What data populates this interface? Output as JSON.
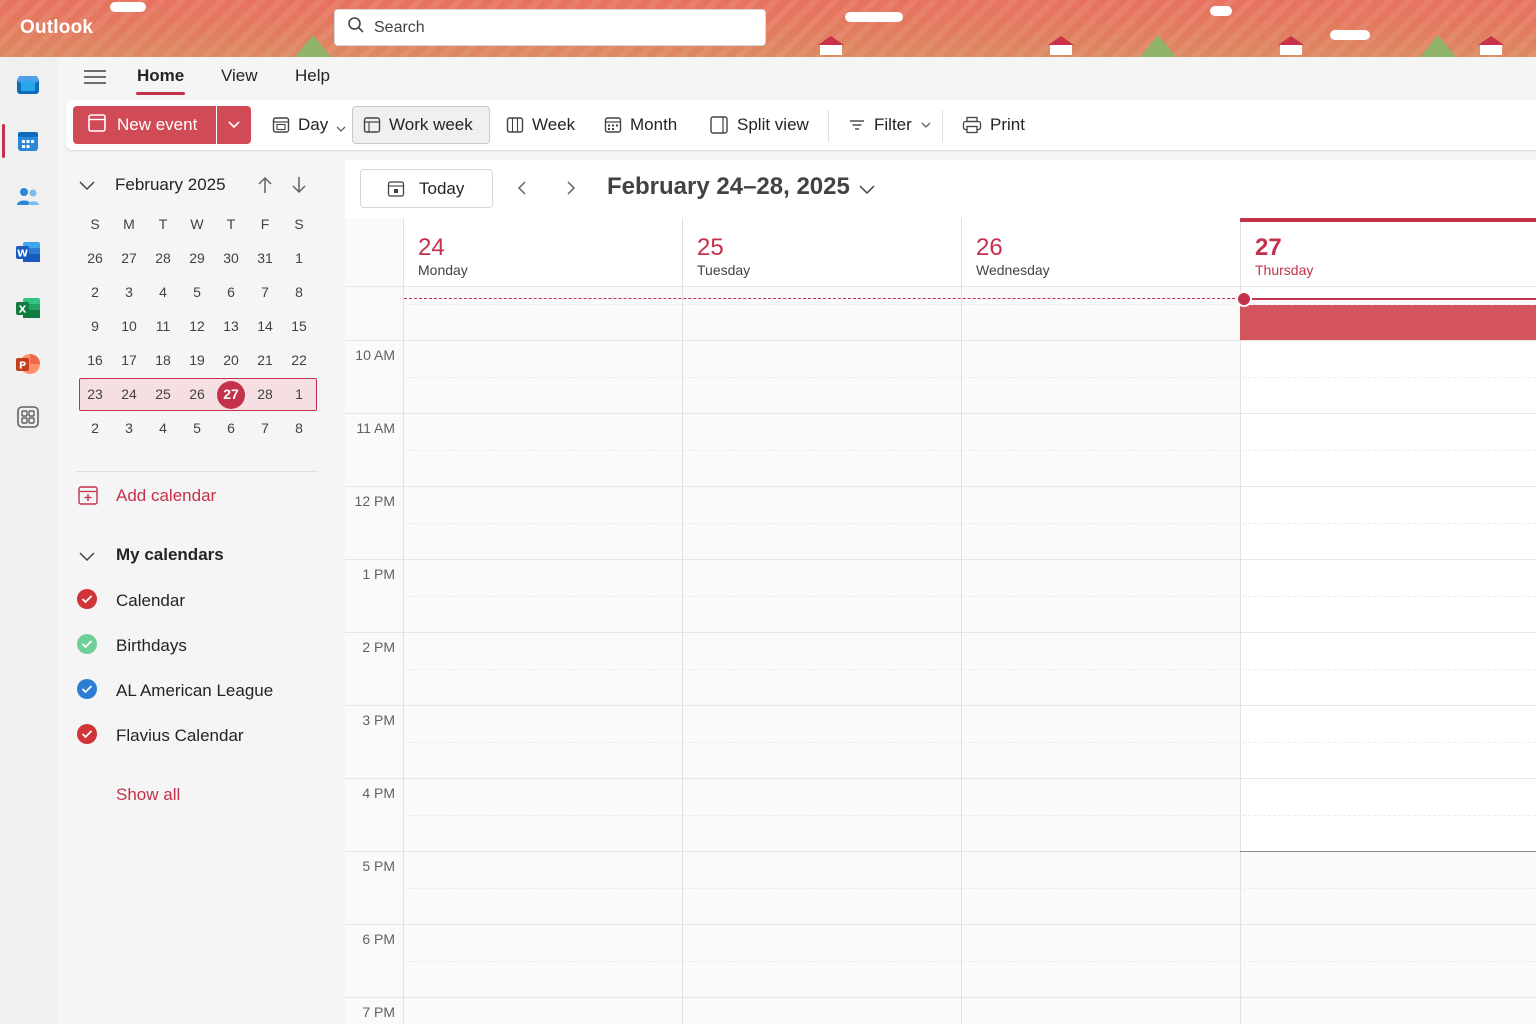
{
  "app": {
    "name": "Outlook"
  },
  "search": {
    "placeholder": "Search"
  },
  "ribbon": {
    "tabs": [
      "Home",
      "View",
      "Help"
    ],
    "active_tab": "Home"
  },
  "toolbar": {
    "new_event": "New event",
    "day": "Day",
    "work_week": "Work week",
    "week": "Week",
    "month": "Month",
    "split_view": "Split view",
    "filter": "Filter",
    "print": "Print",
    "active_view": "Work week"
  },
  "mini_calendar": {
    "title": "February 2025",
    "days_of_week": [
      "S",
      "M",
      "T",
      "W",
      "T",
      "F",
      "S"
    ],
    "weeks": [
      [
        "26",
        "27",
        "28",
        "29",
        "30",
        "31",
        "1"
      ],
      [
        "2",
        "3",
        "4",
        "5",
        "6",
        "7",
        "8"
      ],
      [
        "9",
        "10",
        "11",
        "12",
        "13",
        "14",
        "15"
      ],
      [
        "16",
        "17",
        "18",
        "19",
        "20",
        "21",
        "22"
      ],
      [
        "23",
        "24",
        "25",
        "26",
        "27",
        "28",
        "1"
      ],
      [
        "2",
        "3",
        "4",
        "5",
        "6",
        "7",
        "8"
      ]
    ],
    "today": "27"
  },
  "sidebar": {
    "add_calendar": "Add calendar",
    "my_calendars_title": "My calendars",
    "calendars": [
      {
        "name": "Calendar",
        "color": "#d13438"
      },
      {
        "name": "Birthdays",
        "color": "#6fcf97"
      },
      {
        "name": "AL American League",
        "color": "#2b7cd3"
      },
      {
        "name": "Flavius Calendar",
        "color": "#d13438"
      }
    ],
    "show_all": "Show all"
  },
  "main": {
    "today_button": "Today",
    "range_title": "February 24–28, 2025",
    "days": [
      {
        "num": "24",
        "name": "Monday"
      },
      {
        "num": "25",
        "name": "Tuesday"
      },
      {
        "num": "26",
        "name": "Wednesday"
      },
      {
        "num": "27",
        "name": "Thursday"
      }
    ],
    "time_labels": [
      "10 AM",
      "11 AM",
      "12 PM",
      "1 PM",
      "2 PM",
      "3 PM",
      "4 PM",
      "5 PM",
      "6 PM",
      "7 PM"
    ]
  },
  "colors": {
    "accent": "#c4314b",
    "event": "#d5555f"
  }
}
